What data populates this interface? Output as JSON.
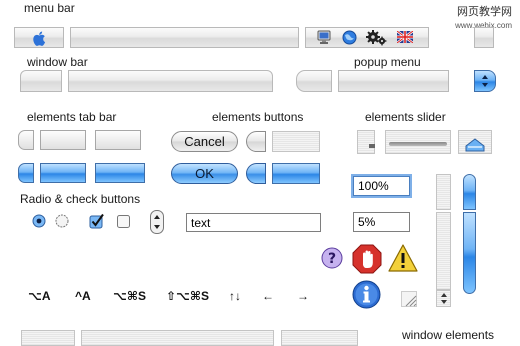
{
  "watermark": {
    "line1": "网页教学网",
    "line2": "www.webjx.com"
  },
  "sections": {
    "menu_bar": "menu bar",
    "window_bar": "window bar",
    "popup_menu": "popup menu",
    "elements_tab_bar": "elements tab bar",
    "elements_buttons": "elements buttons",
    "elements_slider": "elements slider",
    "radio_check": "Radio & check buttons",
    "window_elements": "window elements"
  },
  "buttons": {
    "cancel": "Cancel",
    "ok": "OK"
  },
  "fields": {
    "percent_100": "100%",
    "percent_5": "5%",
    "text": "text"
  },
  "shortcuts": [
    "⌥A",
    "^A",
    "⌥⌘S",
    "⇧⌥⌘S",
    "↑↓",
    "←",
    "→"
  ],
  "icons": {
    "apple": "apple-icon",
    "monitor": "monitor-icon",
    "globe": "globe-icon",
    "gears": "gears-icon",
    "flag": "uk-flag-icon",
    "help": "help-icon",
    "stop": "stop-hand-icon",
    "warning": "warning-icon",
    "info": "info-icon",
    "resize": "resize-grip-icon"
  },
  "colors": {
    "aqua_blue": "#3a8fe8",
    "stop_red": "#d0302b",
    "warning_yellow": "#f3d13a",
    "info_blue": "#2c6bd1",
    "help_purple": "#b69ee6"
  }
}
